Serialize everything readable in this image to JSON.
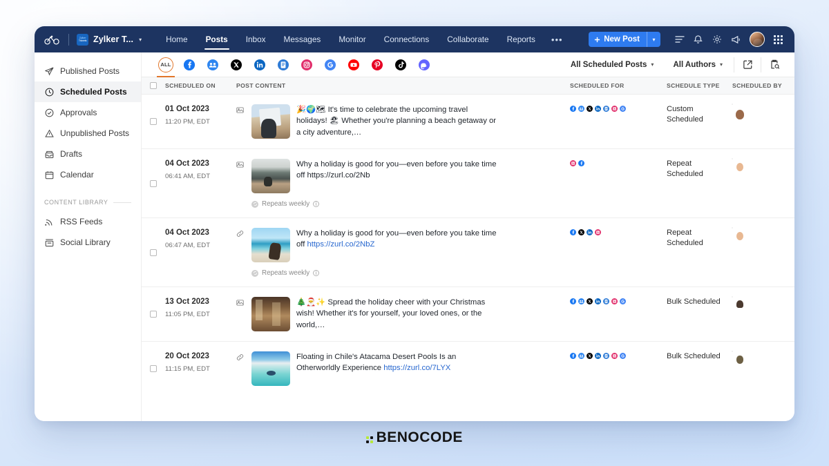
{
  "topnav": {
    "brand_icon": "bicycle-logo-icon",
    "org_tile_lines": [
      "Zylker",
      "Travels"
    ],
    "org_name": "Zylker T...",
    "links": [
      {
        "label": "Home",
        "active": false
      },
      {
        "label": "Posts",
        "active": true
      },
      {
        "label": "Inbox",
        "active": false
      },
      {
        "label": "Messages",
        "active": false
      },
      {
        "label": "Monitor",
        "active": false
      },
      {
        "label": "Connections",
        "active": false
      },
      {
        "label": "Collaborate",
        "active": false
      },
      {
        "label": "Reports",
        "active": false
      }
    ],
    "more_label": "•••",
    "new_post_label": "New Post",
    "icons": [
      "list-lines-icon",
      "bell-icon",
      "gear-icon",
      "megaphone-icon"
    ],
    "avatar": "user-avatar",
    "apps_icon": "apps-grid-icon"
  },
  "sidebar": {
    "items": [
      {
        "label": "Published Posts",
        "icon": "paper-plane-icon",
        "active": false
      },
      {
        "label": "Scheduled Posts",
        "icon": "clock-icon",
        "active": true
      },
      {
        "label": "Approvals",
        "icon": "check-circle-icon",
        "active": false
      },
      {
        "label": "Unpublished Posts",
        "icon": "warning-triangle-icon",
        "active": false
      },
      {
        "label": "Drafts",
        "icon": "drafts-tray-icon",
        "active": false
      },
      {
        "label": "Calendar",
        "icon": "calendar-icon",
        "active": false
      }
    ],
    "section_label": "CONTENT LIBRARY",
    "library_items": [
      {
        "label": "RSS Feeds",
        "icon": "rss-icon"
      },
      {
        "label": "Social Library",
        "icon": "library-box-icon"
      }
    ]
  },
  "channel_bar": {
    "all_label": "ALL",
    "channels": [
      {
        "name": "facebook-icon",
        "color": "#1877F2",
        "glyph": "f"
      },
      {
        "name": "facebook-group-icon",
        "color": "#1877F2",
        "glyph": "g"
      },
      {
        "name": "x-twitter-icon",
        "color": "#000000",
        "glyph": "x"
      },
      {
        "name": "linkedin-icon",
        "color": "#0A66C2",
        "glyph": "in"
      },
      {
        "name": "blogger-icon",
        "color": "#2E7BD6",
        "glyph": "b"
      },
      {
        "name": "instagram-icon",
        "color": "#E1306C",
        "glyph": "ig"
      },
      {
        "name": "google-business-icon",
        "color": "#4285F4",
        "glyph": "G"
      },
      {
        "name": "youtube-icon",
        "color": "#FF0000",
        "glyph": "yt"
      },
      {
        "name": "pinterest-icon",
        "color": "#E60023",
        "glyph": "P"
      },
      {
        "name": "tiktok-icon",
        "color": "#000000",
        "glyph": "tt"
      },
      {
        "name": "mastodon-icon",
        "color": "#6364FF",
        "glyph": "m"
      }
    ],
    "filter_posts": "All Scheduled Posts",
    "filter_authors": "All Authors",
    "tools": [
      "export-icon",
      "audit-search-icon"
    ]
  },
  "table": {
    "columns": [
      "SCHEDULED ON",
      "POST CONTENT",
      "SCHEDULED FOR",
      "SCHEDULE TYPE",
      "SCHEDULED BY"
    ],
    "rows": [
      {
        "date": "01 Oct 2023",
        "time": "11:20 PM, EDT",
        "attachment": "image-attachment-icon",
        "thumb": "th1",
        "text": "🎉🌍🗺 It's time to celebrate the upcoming travel holidays! 🏖 Whether you're planning a beach getaway or a city adventure,…",
        "link": "",
        "repeat": "",
        "channels": [
          {
            "name": "facebook-icon",
            "color": "#1877F2"
          },
          {
            "name": "facebook-group-icon",
            "color": "#2E86F0"
          },
          {
            "name": "x-twitter-icon",
            "color": "#000000"
          },
          {
            "name": "linkedin-icon",
            "color": "#0A66C2"
          },
          {
            "name": "blogger-icon",
            "color": "#2E7BD6"
          },
          {
            "name": "instagram-icon",
            "color": "#E1306C"
          },
          {
            "name": "google-business-icon",
            "color": "#4285F4"
          }
        ],
        "type": "Custom Scheduled",
        "avatar": "av-a"
      },
      {
        "date": "04 Oct 2023",
        "time": "06:41 AM, EDT",
        "attachment": "image-attachment-icon",
        "thumb": "th2",
        "text": "Why a holiday is good for you—even before you take time off https://zurl.co/2Nb",
        "link": "",
        "repeat": "Repeats weekly",
        "channels": [
          {
            "name": "instagram-icon",
            "color": "#E1306C"
          },
          {
            "name": "facebook-icon",
            "color": "#1877F2"
          }
        ],
        "type": "Repeat Scheduled",
        "avatar": "av-b"
      },
      {
        "date": "04 Oct 2023",
        "time": "06:47 AM, EDT",
        "attachment": "link-attachment-icon",
        "thumb": "th3",
        "text": "Why a holiday is good for you—even before you take time off ",
        "link": "https://zurl.co/2NbZ",
        "repeat": "Repeats weekly",
        "channels": [
          {
            "name": "facebook-icon",
            "color": "#1877F2"
          },
          {
            "name": "x-twitter-icon",
            "color": "#000000"
          },
          {
            "name": "linkedin-icon",
            "color": "#0A66C2"
          },
          {
            "name": "instagram-icon",
            "color": "#E1306C"
          }
        ],
        "type": "Repeat Scheduled",
        "avatar": "av-b"
      },
      {
        "date": "13 Oct 2023",
        "time": "11:05 PM, EDT",
        "attachment": "image-attachment-icon",
        "thumb": "th4",
        "text": "🎄🎅✨ Spread the holiday cheer with your Christmas wish! Whether it's for yourself, your loved ones, or the world,…",
        "link": "",
        "repeat": "",
        "channels": [
          {
            "name": "facebook-icon",
            "color": "#1877F2"
          },
          {
            "name": "facebook-group-icon",
            "color": "#2E86F0"
          },
          {
            "name": "x-twitter-icon",
            "color": "#000000"
          },
          {
            "name": "linkedin-icon",
            "color": "#0A66C2"
          },
          {
            "name": "blogger-icon",
            "color": "#2E7BD6"
          },
          {
            "name": "instagram-icon",
            "color": "#E1306C"
          },
          {
            "name": "google-business-icon",
            "color": "#4285F4"
          }
        ],
        "type": "Bulk Scheduled",
        "avatar": "av-c"
      },
      {
        "date": "20 Oct 2023",
        "time": "11:15 PM, EDT",
        "attachment": "link-attachment-icon",
        "thumb": "th5",
        "text": "Floating in Chile's Atacama Desert Pools Is an Otherworldly Experience ",
        "link": "https://zurl.co/7LYX",
        "repeat": "",
        "channels": [
          {
            "name": "facebook-icon",
            "color": "#1877F2"
          },
          {
            "name": "facebook-group-icon",
            "color": "#2E86F0"
          },
          {
            "name": "x-twitter-icon",
            "color": "#000000"
          },
          {
            "name": "linkedin-icon",
            "color": "#0A66C2"
          },
          {
            "name": "blogger-icon",
            "color": "#2E7BD6"
          },
          {
            "name": "instagram-icon",
            "color": "#E1306C"
          },
          {
            "name": "google-business-icon",
            "color": "#4285F4"
          }
        ],
        "type": "Bulk Scheduled",
        "avatar": "av-d"
      }
    ]
  },
  "footer": {
    "logo_text": "BENOCODE",
    "logo_accent": "#b6e83a"
  }
}
